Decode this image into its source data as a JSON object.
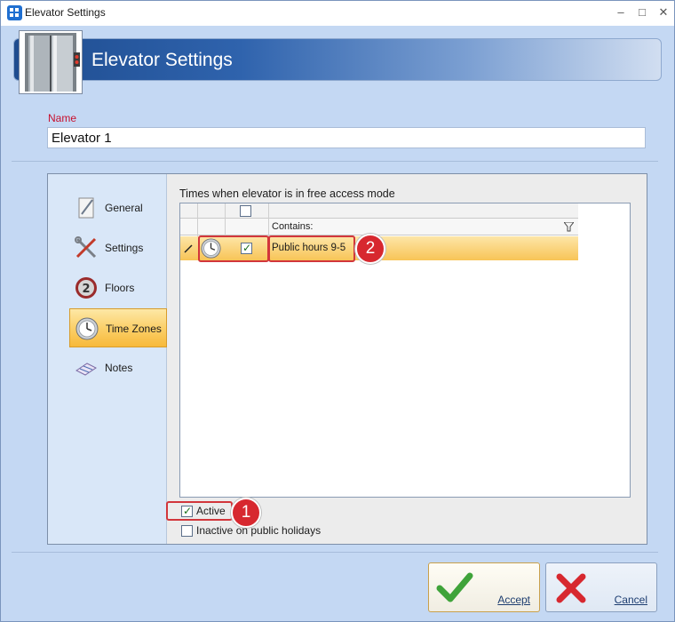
{
  "window": {
    "title": "Elevator Settings"
  },
  "header": {
    "title": "Elevator Settings"
  },
  "name_field": {
    "label": "Name",
    "value": "Elevator 1"
  },
  "sidebar": {
    "items": [
      {
        "label": "General",
        "icon": "general-icon"
      },
      {
        "label": "Settings",
        "icon": "settings-icon"
      },
      {
        "label": "Floors",
        "icon": "floors-icon"
      },
      {
        "label": "Time Zones",
        "icon": "clock-icon",
        "active": true
      },
      {
        "label": "Notes",
        "icon": "notes-icon"
      }
    ]
  },
  "time_zones": {
    "caption": "Times when elevator is in free access mode",
    "filter_label": "Contains:",
    "rows": [
      {
        "checked": true,
        "name": "Public hours 9-5"
      }
    ]
  },
  "options": {
    "active_label": "Active",
    "active_checked": true,
    "inactive_holidays_label": "Inactive on public holidays",
    "inactive_holidays_checked": false
  },
  "callouts": {
    "one": "1",
    "two": "2"
  },
  "buttons": {
    "accept": "Accept",
    "cancel": "Cancel"
  },
  "colors": {
    "accent_red": "#d7282f",
    "selection": "#f8c456",
    "banner": "#2f63ad"
  }
}
